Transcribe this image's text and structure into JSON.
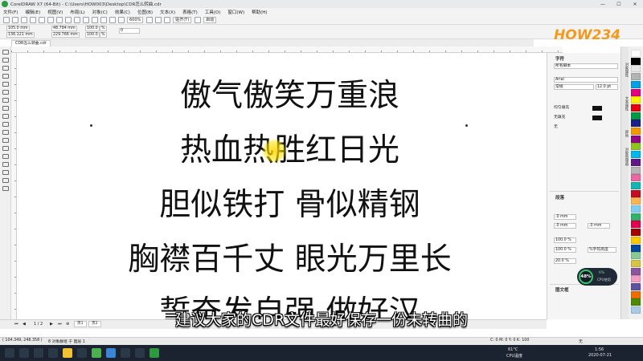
{
  "window": {
    "title": "CorelDRAW X7 (64-Bit) - C:\\Users\\HOW003\\Desktop\\CDR怎么转曲.cdr",
    "controls": [
      "—",
      "☐",
      "✕"
    ]
  },
  "menu": [
    "文件(F)",
    "编辑(E)",
    "视图(V)",
    "布局(L)",
    "对象(C)",
    "效果(C)",
    "位图(B)",
    "文本(X)",
    "表格(T)",
    "工具(O)",
    "窗口(W)",
    "帮助(H)"
  ],
  "toolbar": {
    "zoom": "600%",
    "snap": "贴齐(T)",
    "start_btn": "启动"
  },
  "propbar": {
    "x": "105.0 mm",
    "y": "136.121 mm",
    "w": "48.794 mm",
    "h": "229.766 mm",
    "sx": "100.0",
    "sy": "100.0",
    "angle": "0",
    "pct": "%"
  },
  "brand": {
    "logo_text": "HOW234"
  },
  "document": {
    "tab": "CDR怎么转曲.cdr",
    "lines": [
      "傲气傲笑万重浪",
      "热血热胜红日光",
      "胆似铁打 骨似精钢",
      "胸襟百千丈 眼光万里长",
      "誓奋发自强 做好汉"
    ]
  },
  "docker": {
    "char_title": "字符",
    "script": "所有脚本",
    "font": "Arial",
    "style": "常规",
    "size": "12.0 pt",
    "fill_label": "均匀填充",
    "bg_label": "无填充",
    "outline_label": "无",
    "para_title": "段落",
    "para_fields": [
      ".0 mm",
      ".0 mm",
      ".0 mm",
      "100.0 %",
      "100.0 %",
      "20.0 %"
    ],
    "para_label": "%字符高度",
    "frame_title": "图文框"
  },
  "sidetabs": [
    "对象属性",
    "文本属性",
    "颜色",
    "对象管理器"
  ],
  "palette": [
    "#ffffff",
    "#000000",
    "#e6e6e6",
    "#b3b3b3",
    "#00a0e9",
    "#e4007f",
    "#fff100",
    "#e60012",
    "#009944",
    "#1d2088",
    "#f39800",
    "#920783",
    "#8fc31f",
    "#00b7ee",
    "#601986",
    "#b5b5b6",
    "#ea68a2",
    "#13b5b1",
    "#c30d23",
    "#f8b551",
    "#7ecef4",
    "#32b16c",
    "#e5004f",
    "#a40000",
    "#fcc800",
    "#00479d",
    "#89c997",
    "#d7c447",
    "#8957a1",
    "#f19ec2",
    "#5f52a0",
    "#ed6d00",
    "#4e8a00",
    "#aacbe8"
  ],
  "perf": {
    "value": "48%",
    "sub": "6%",
    "label": "CPU使用"
  },
  "subtitle": "建议大家的CDR文件最好保存一份未转曲的",
  "pagebar": {
    "nav": "1 / 2",
    "page1": "页1",
    "page2": "页2"
  },
  "status": {
    "coords": "( 104.349, 248.358 )",
    "info": "8 对象群组 于 图层 1",
    "fill": "C: 0 M: 0 Y: 0 K: 100",
    "none": "无"
  },
  "taskbar": {
    "temp": "61°C",
    "temp_label": "CPU温度",
    "time": "1:56",
    "date": "2020-07-21"
  }
}
